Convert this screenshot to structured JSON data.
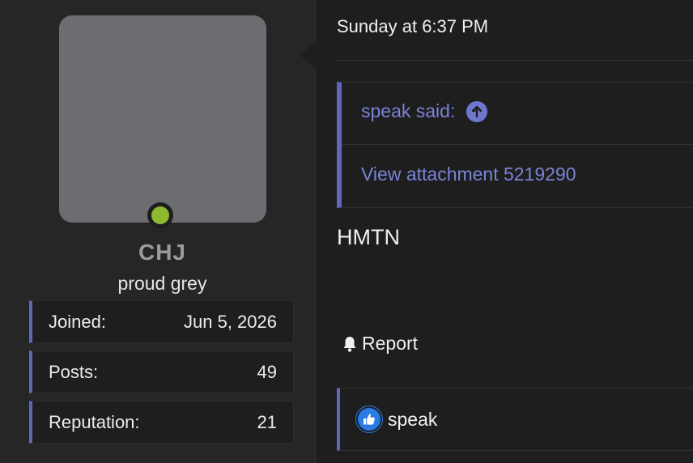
{
  "user": {
    "username": "CHJ",
    "title": "proud grey",
    "online_status_color": "#8cb930",
    "stats": [
      {
        "label": "Joined:",
        "value": "Jun 5, 2026"
      },
      {
        "label": "Posts:",
        "value": "49"
      },
      {
        "label": "Reputation:",
        "value": "21"
      }
    ]
  },
  "post": {
    "date": "Sunday at 6:37 PM",
    "quote": {
      "header": "speak said:",
      "header_icon": "arrow-up-circle-icon",
      "attachment_link": "View attachment 5219290"
    },
    "message": "HMTN",
    "report_label": "Report",
    "report_icon": "bell-icon",
    "reactions": {
      "icon": "thumbs-up-icon",
      "users": "speak"
    }
  },
  "colors": {
    "accent": "#5e67b8",
    "link": "#7a83d4",
    "like": "#2a7be4"
  }
}
